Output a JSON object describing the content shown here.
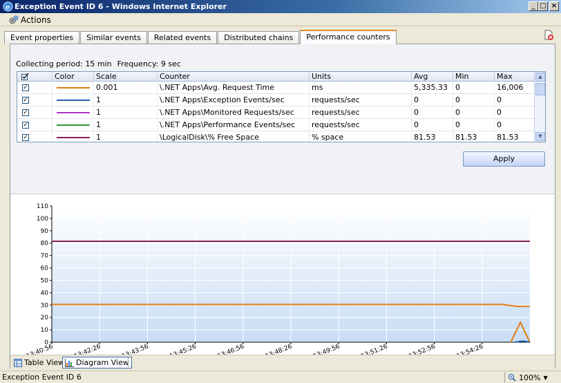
{
  "window": {
    "title": "Exception Event ID 6 - Windows Internet Explorer",
    "minimize": "_",
    "maximize": "□",
    "close": "×"
  },
  "menubar": {
    "actions_label": "Actions"
  },
  "tabs": [
    {
      "label": "Event properties"
    },
    {
      "label": "Similar events"
    },
    {
      "label": "Related events"
    },
    {
      "label": "Distributed chains"
    },
    {
      "label": "Performance counters"
    }
  ],
  "collecting": {
    "period": "Collecting period: 15 min",
    "frequency": "Frequency: 9 sec"
  },
  "grid": {
    "columns": [
      "Color",
      "Scale",
      "Counter",
      "Units",
      "Avg",
      "Min",
      "Max"
    ],
    "rows": [
      {
        "checked": "✓",
        "color": "#e07b10",
        "scale": "0.001",
        "counter": "\\.NET Apps\\Avg. Request Time",
        "units": "ms",
        "avg": "5,335.33",
        "min": "0",
        "max": "16,006"
      },
      {
        "checked": "✓",
        "color": "#1f5fb0",
        "scale": "1",
        "counter": "\\.NET Apps\\Exception Events/sec",
        "units": "requests/sec",
        "avg": "0",
        "min": "0",
        "max": "0"
      },
      {
        "checked": "✓",
        "color": "#b030c8",
        "scale": "1",
        "counter": "\\.NET Apps\\Monitored Requests/sec",
        "units": "requests/sec",
        "avg": "0",
        "min": "0",
        "max": "0"
      },
      {
        "checked": "✓",
        "color": "#2e9a2e",
        "scale": "1",
        "counter": "\\.NET Apps\\Performance Events/sec",
        "units": "requests/sec",
        "avg": "0",
        "min": "0",
        "max": "0"
      },
      {
        "checked": "✓",
        "color": "#8a1e5a",
        "scale": "1",
        "counter": "\\LogicalDisk\\% Free Space",
        "units": "% space",
        "avg": "81.53",
        "min": "81.53",
        "max": "81.53"
      }
    ]
  },
  "apply_label": "Apply",
  "chart_data": {
    "type": "line",
    "ylim": [
      0,
      110
    ],
    "yticks": [
      "0",
      "10",
      "20",
      "30",
      "40",
      "50",
      "60",
      "70",
      "80",
      "90",
      "100",
      "110"
    ],
    "xticks": [
      "13:40:56",
      "13:42:26",
      "13:43:56",
      "13:45:26",
      "13:46:56",
      "13:48:26",
      "13:49:56",
      "13:51:26",
      "13:52:56",
      "13:54:26"
    ],
    "xlim": [
      "13:40:56",
      "13:55:56"
    ],
    "grid": true,
    "series": [
      {
        "color": "#8a1e5a",
        "x": [
          "13:40:56",
          "13:55:56"
        ],
        "y": [
          81.53,
          81.53
        ]
      },
      {
        "color": "#e07b10",
        "x": [
          "13:40:56",
          "13:55:05",
          "13:55:20",
          "13:55:35",
          "13:55:56"
        ],
        "y": [
          30.5,
          30.5,
          29.6,
          28.9,
          28.9
        ]
      },
      {
        "color": "#e07b10",
        "x": [
          "13:55:20",
          "13:55:29",
          "13:55:38",
          "13:55:47",
          "13:55:56"
        ],
        "y": [
          0,
          8,
          16,
          8,
          0
        ]
      },
      {
        "color": "#1f5fb0",
        "x": [
          "13:55:29",
          "13:55:38",
          "13:55:47",
          "13:55:56"
        ],
        "y": [
          0,
          0.8,
          0.8,
          0
        ]
      }
    ]
  },
  "bottom": {
    "table_view": "Table View",
    "diagram_view": "Diagram View"
  },
  "status": {
    "text": "Exception Event ID 6",
    "zoom": "100%"
  }
}
